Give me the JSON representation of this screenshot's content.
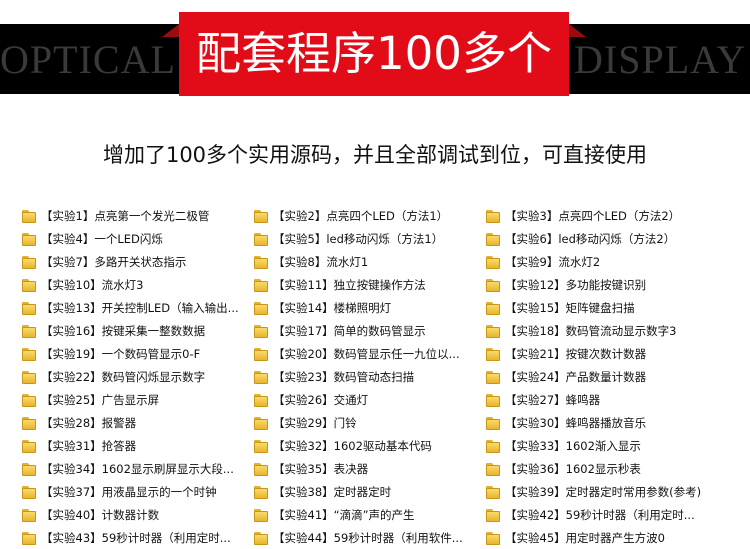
{
  "banner": {
    "band_left_text": "OPTICAL D",
    "band_right_text": "DISPLAY",
    "title": "配套程序100多个"
  },
  "subtitle": "增加了100多个实用源码，并且全部调试到位，可直接使用",
  "experiments": [
    "【实验1】点亮第一个发光二极管",
    "【实验2】点亮四个LED（方法1）",
    "【实验3】点亮四个LED（方法2）",
    "【实验4】一个LED闪烁",
    "【实验5】led移动闪烁（方法1）",
    "【实验6】led移动闪烁（方法2）",
    "【实验7】多路开关状态指示",
    "【实验8】流水灯1",
    "【实验9】流水灯2",
    "【实验10】流水灯3",
    "【实验11】独立按键操作方法",
    "【实验12】多功能按键识别",
    "【实验13】开关控制LED（输入输出...",
    "【实验14】楼梯照明灯",
    "【实验15】矩阵键盘扫描",
    "【实验16】按键采集一整数数据",
    "【实验17】简单的数码管显示",
    "【实验18】数码管流动显示数字3",
    "【实验19】一个数码管显示0-F",
    "【实验20】数码管显示任一九位以...",
    "【实验21】按键次数计数器",
    "【实验22】数码管闪烁显示数字",
    "【实验23】数码管动态扫描",
    "【实验24】产品数量计数器",
    "【实验25】广告显示屏",
    "【实验26】交通灯",
    "【实验27】蜂鸣器",
    "【实验28】报警器",
    "【实验29】门铃",
    "【实验30】蜂鸣器播放音乐",
    "【实验31】抢答器",
    "【实验32】1602驱动基本代码",
    "【实验33】1602渐入显示",
    "【实验34】1602显示刷屏显示大段...",
    "【实验35】表决器",
    "【实验36】1602显示秒表",
    "【实验37】用液晶显示的一个时钟",
    "【实验38】定时器定时",
    "【实验39】定时器定时常用参数(参考)",
    "【实验40】计数器计数",
    "【实验41】“滴滴”声的产生",
    "【实验42】59秒计时器（利用定时...",
    "【实验43】59秒计时器（利用定时...",
    "【实验44】59秒计时器（利用软件...",
    "【实验45】用定时器产生方波0"
  ]
}
